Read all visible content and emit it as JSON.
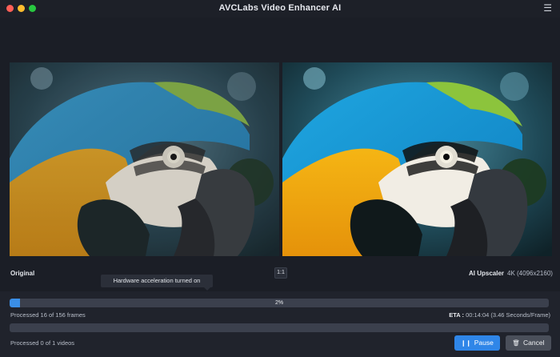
{
  "window": {
    "title": "AVCLabs Video Enhancer AI"
  },
  "preview": {
    "original_label": "Original",
    "ratio_button": "1:1",
    "model_label": "AI Upscaler",
    "resolution_label": "4K (4096x2160)"
  },
  "tooltip": {
    "text": "Hardware acceleration turned on"
  },
  "progress": {
    "percent_label": "2%",
    "fraction": 0.02,
    "frames_text": "Processed 16 of 156 frames",
    "eta_label": "ETA :",
    "eta_value": "00:14:04 (3.46 Seconds/Frame)",
    "videos_text": "Processed 0 of 1 videos",
    "videos_fraction": 0
  },
  "actions": {
    "pause_label": "Pause",
    "cancel_label": "Cancel"
  },
  "icons": {
    "menu": "hamburger-menu-icon",
    "pause": "pause-icon",
    "cancel": "trash-icon"
  },
  "colors": {
    "accent": "#2f86e8",
    "progress_fill": "#3a8ee6",
    "background": "#1b1e26"
  }
}
